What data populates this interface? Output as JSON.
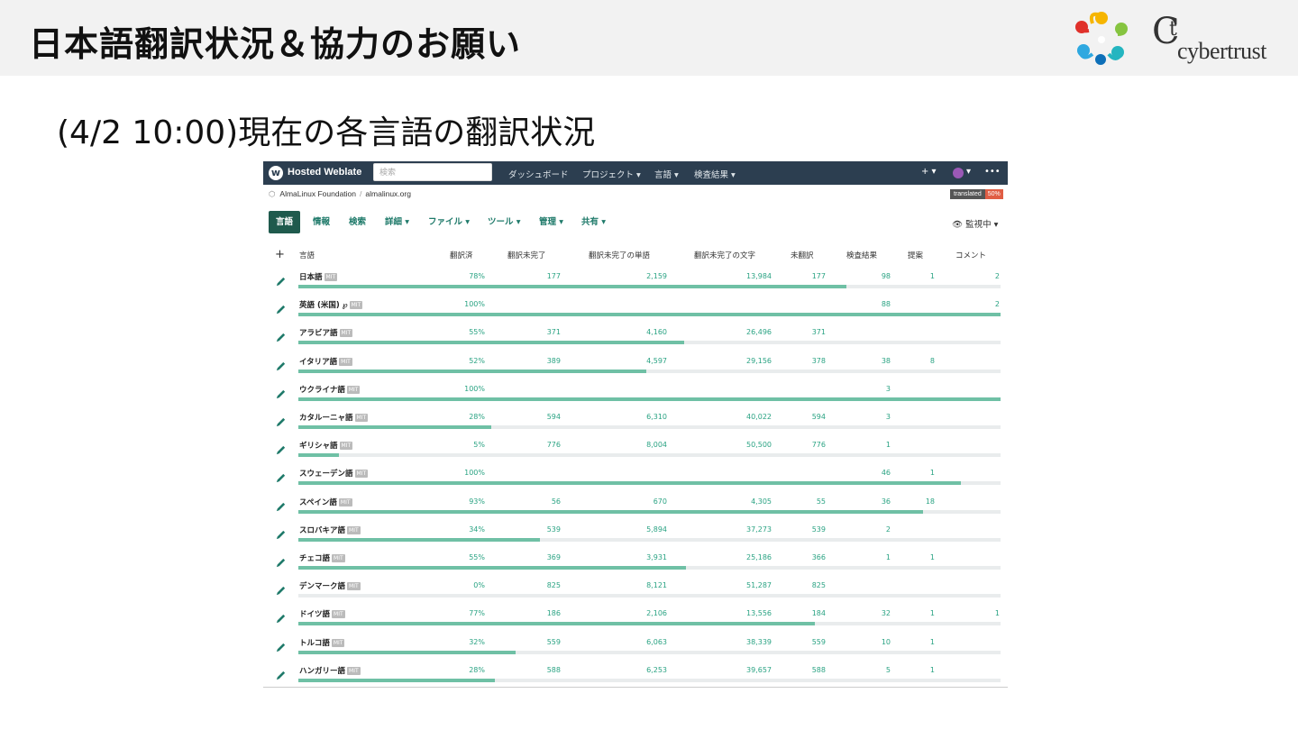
{
  "slide": {
    "title": "日本語翻訳状況＆協力のお願い",
    "subtitle": "(4/2 10:00)現在の各言語の翻訳状況",
    "logo_text_c": "C",
    "logo_text_t": "t",
    "logo_word": "cybertrust"
  },
  "colors": {
    "accent": "#1f5a4d",
    "number": "#2aa383",
    "bar": "#6fc0a5",
    "topbar": "#2c3e50"
  },
  "weblate": {
    "brand": "Hosted Weblate",
    "search_placeholder": "検索",
    "nav": [
      "ダッシュボード",
      "プロジェクト ▾",
      "言語 ▾",
      "検査結果 ▾"
    ],
    "right_icons": [
      "+ ▾",
      "▾",
      "•••"
    ],
    "breadcrumb": {
      "project": "AlmaLinux Foundation",
      "sep": "/",
      "component": "almalinux.org"
    },
    "badge": {
      "label": "translated",
      "value": "50%"
    },
    "tabs": [
      "言語",
      "情報",
      "検索",
      "詳細 ▾",
      "ファイル ▾",
      "ツール ▾",
      "管理 ▾",
      "共有 ▾"
    ],
    "watch": "監視中 ▾",
    "columns": [
      "言語",
      "翻訳済",
      "翻訳未完了",
      "翻訳未完了の単語",
      "翻訳未完了の文字",
      "未翻訳",
      "検査結果",
      "提案",
      "コメント"
    ],
    "rows": [
      {
        "name": "日本語",
        "suffix": "",
        "license": "MIT",
        "translated": "78%",
        "pct": 0.78,
        "unfinished": "177",
        "words": "2,159",
        "chars": "13,984",
        "untranslated": "177",
        "checks": "98",
        "suggestions": "1",
        "comments": "2"
      },
      {
        "name": "英語 (米国)",
        "suffix": " ℘",
        "license": "MIT",
        "translated": "100%",
        "pct": 1.0,
        "unfinished": "",
        "words": "",
        "chars": "",
        "untranslated": "",
        "checks": "88",
        "suggestions": "",
        "comments": "2"
      },
      {
        "name": "アラビア語",
        "suffix": "",
        "license": "MIT",
        "translated": "55%",
        "pct": 0.55,
        "unfinished": "371",
        "words": "4,160",
        "chars": "26,496",
        "untranslated": "371",
        "checks": "",
        "suggestions": "",
        "comments": ""
      },
      {
        "name": "イタリア語",
        "suffix": "",
        "license": "MIT",
        "translated": "52%",
        "pct": 0.495,
        "unfinished": "389",
        "words": "4,597",
        "chars": "29,156",
        "untranslated": "378",
        "checks": "38",
        "suggestions": "8",
        "comments": ""
      },
      {
        "name": "ウクライナ語",
        "suffix": "",
        "license": "MIT",
        "translated": "100%",
        "pct": 1.0,
        "unfinished": "",
        "words": "",
        "chars": "",
        "untranslated": "",
        "checks": "3",
        "suggestions": "",
        "comments": ""
      },
      {
        "name": "カタルーニャ語",
        "suffix": "",
        "license": "MIT",
        "translated": "28%",
        "pct": 0.275,
        "unfinished": "594",
        "words": "6,310",
        "chars": "40,022",
        "untranslated": "594",
        "checks": "3",
        "suggestions": "",
        "comments": ""
      },
      {
        "name": "ギリシャ語",
        "suffix": "",
        "license": "MIT",
        "translated": "5%",
        "pct": 0.058,
        "unfinished": "776",
        "words": "8,004",
        "chars": "50,500",
        "untranslated": "776",
        "checks": "1",
        "suggestions": "",
        "comments": ""
      },
      {
        "name": "スウェーデン語",
        "suffix": "",
        "license": "MIT",
        "translated": "100%",
        "pct": 0.944,
        "unfinished": "",
        "words": "",
        "chars": "",
        "untranslated": "",
        "checks": "46",
        "suggestions": "1",
        "comments": ""
      },
      {
        "name": "スペイン語",
        "suffix": "",
        "license": "MIT",
        "translated": "93%",
        "pct": 0.889,
        "unfinished": "56",
        "words": "670",
        "chars": "4,305",
        "untranslated": "55",
        "checks": "36",
        "suggestions": "18",
        "comments": ""
      },
      {
        "name": "スロバキア語",
        "suffix": "",
        "license": "MIT",
        "translated": "34%",
        "pct": 0.344,
        "unfinished": "539",
        "words": "5,894",
        "chars": "37,273",
        "untranslated": "539",
        "checks": "2",
        "suggestions": "",
        "comments": ""
      },
      {
        "name": "チェコ語",
        "suffix": "",
        "license": "MIT",
        "translated": "55%",
        "pct": 0.552,
        "unfinished": "369",
        "words": "3,931",
        "chars": "25,186",
        "untranslated": "366",
        "checks": "1",
        "suggestions": "1",
        "comments": ""
      },
      {
        "name": "デンマーク語",
        "suffix": "",
        "license": "MIT",
        "translated": "0%",
        "pct": 0.0,
        "unfinished": "825",
        "words": "8,121",
        "chars": "51,287",
        "untranslated": "825",
        "checks": "",
        "suggestions": "",
        "comments": ""
      },
      {
        "name": "ドイツ語",
        "suffix": "",
        "license": "MIT",
        "translated": "77%",
        "pct": 0.735,
        "unfinished": "186",
        "words": "2,106",
        "chars": "13,556",
        "untranslated": "184",
        "checks": "32",
        "suggestions": "1",
        "comments": "1"
      },
      {
        "name": "トルコ語",
        "suffix": "",
        "license": "MIT",
        "translated": "32%",
        "pct": 0.31,
        "unfinished": "559",
        "words": "6,063",
        "chars": "38,339",
        "untranslated": "559",
        "checks": "10",
        "suggestions": "1",
        "comments": ""
      },
      {
        "name": "ハンガリー語",
        "suffix": "",
        "license": "MIT",
        "translated": "28%",
        "pct": 0.28,
        "unfinished": "588",
        "words": "6,253",
        "chars": "39,657",
        "untranslated": "588",
        "checks": "5",
        "suggestions": "1",
        "comments": ""
      }
    ]
  }
}
